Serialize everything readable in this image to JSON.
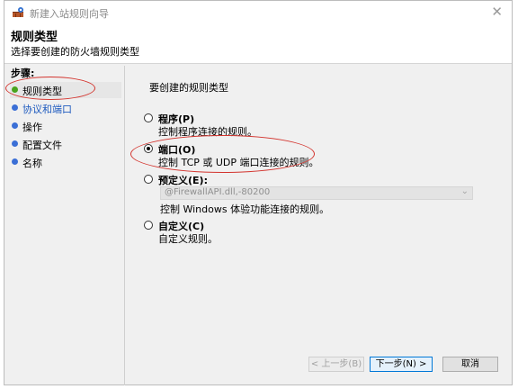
{
  "window": {
    "title": "新建入站规则向导"
  },
  "header": {
    "title": "规则类型",
    "subtitle": "选择要创建的防火墙规则类型"
  },
  "steps": {
    "label": "步骤:",
    "items": [
      {
        "label": "规则类型",
        "color": "#49a31e",
        "active": true
      },
      {
        "label": "协议和端口",
        "color": "#3b6fd6",
        "active": false,
        "link": true
      },
      {
        "label": "操作",
        "color": "#3b6fd6",
        "active": false
      },
      {
        "label": "配置文件",
        "color": "#3b6fd6",
        "active": false
      },
      {
        "label": "名称",
        "color": "#3b6fd6",
        "active": false
      }
    ]
  },
  "main": {
    "prompt": "要创建的规则类型",
    "options": [
      {
        "title": "程序(P)",
        "desc": "控制程序连接的规则。",
        "checked": false
      },
      {
        "title": "端口(O)",
        "desc": "控制 TCP 或 UDP 端口连接的规则。",
        "checked": true
      },
      {
        "title": "预定义(E):",
        "desc": "控制 Windows 体验功能连接的规则。",
        "checked": false
      },
      {
        "title": "自定义(C)",
        "desc": "自定义规则。",
        "checked": false
      }
    ],
    "predefined_select": {
      "value": "@FirewallAPI.dll,-80200"
    }
  },
  "buttons": {
    "back": "< 上一步(B)",
    "next": "下一步(N) >",
    "cancel": "取消"
  },
  "colors": {
    "annotation": "#d3342e",
    "active_step": "#49a31e",
    "link": "#1f5bbf"
  }
}
